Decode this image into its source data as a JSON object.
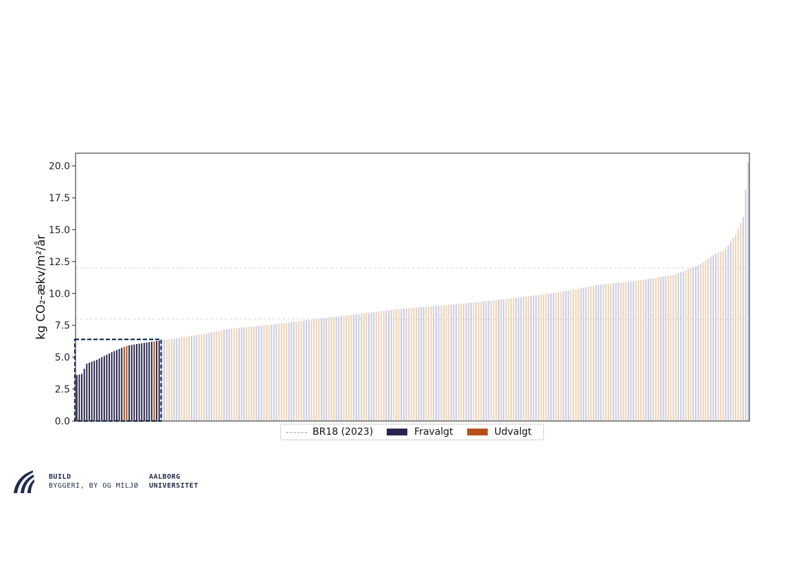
{
  "chart_data": {
    "type": "bar",
    "ylabel": "kg CO₂-ækv/m²/år",
    "ylim": [
      0,
      21
    ],
    "yticks": [
      "0.0",
      "2.5",
      "5.0",
      "7.5",
      "10.0",
      "12.5",
      "15.0",
      "17.5",
      "20.0"
    ],
    "ytick_values": [
      0,
      2.5,
      5,
      7.5,
      10,
      12.5,
      15,
      17.5,
      20
    ],
    "reference_lines": [
      8.0,
      12.0
    ],
    "highlight_box_max": 6.4,
    "highlight_count": 34,
    "udvalgt_indices": [
      19,
      20,
      31
    ],
    "n_bars": 270,
    "value_profile": {
      "x": [
        0,
        2,
        4,
        8,
        14,
        20,
        26,
        33,
        40,
        50,
        60,
        80,
        100,
        130,
        160,
        190,
        210,
        225,
        240,
        250,
        255,
        260,
        264,
        267,
        269
      ],
      "y": [
        3.6,
        3.7,
        4.5,
        4.8,
        5.4,
        5.9,
        6.1,
        6.3,
        6.5,
        6.8,
        7.2,
        7.6,
        8.1,
        8.8,
        9.3,
        10.0,
        10.7,
        11.0,
        11.5,
        12.3,
        13.0,
        13.5,
        14.6,
        16.0,
        20.3
      ]
    },
    "legend": [
      {
        "label": "BR18 (2023)",
        "style": "dashed",
        "color": "#999999"
      },
      {
        "label": "Fravalgt",
        "color": "#272450"
      },
      {
        "label": "Udvalgt",
        "color": "#b5501a"
      }
    ],
    "colors": {
      "fravalgt": "#272450",
      "udvalgt": "#b5501a",
      "faded_a": "#c9cbe0",
      "faded_b": "#f0d2b7",
      "box": "#163160"
    }
  },
  "footer": {
    "build_title": "BUILD",
    "build_subtitle": "BYGGERI, BY OG MILJØ",
    "university_line1": "AALBORG",
    "university_line2": "UNIVERSITET"
  }
}
